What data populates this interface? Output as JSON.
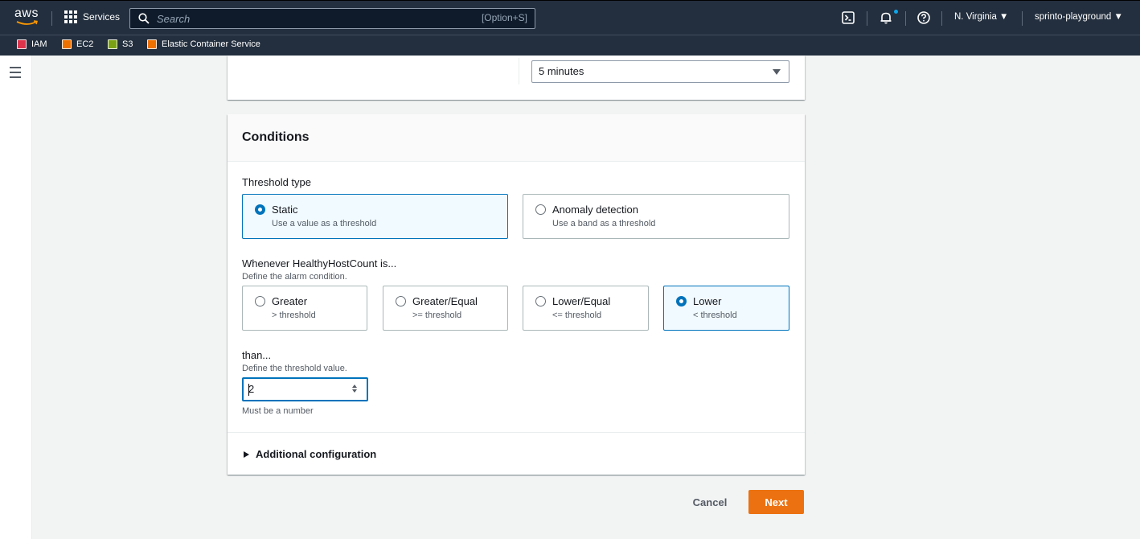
{
  "topnav": {
    "logo_text": "aws",
    "services_label": "Services",
    "search_placeholder": "Search",
    "search_shortcut": "[Option+S]",
    "region": "N. Virginia ▼",
    "account": "sprinto-playground ▼"
  },
  "favorites": [
    {
      "label": "IAM",
      "color": "#dd344c"
    },
    {
      "label": "EC2",
      "color": "#ed7100"
    },
    {
      "label": "S3",
      "color": "#7aa116"
    },
    {
      "label": "Elastic Container Service",
      "color": "#ed7100"
    }
  ],
  "period_select": {
    "value": "5 minutes"
  },
  "conditions": {
    "title": "Conditions",
    "threshold_type_label": "Threshold type",
    "threshold_types": [
      {
        "title": "Static",
        "sub": "Use a value as a threshold",
        "selected": true
      },
      {
        "title": "Anomaly detection",
        "sub": "Use a band as a threshold",
        "selected": false
      }
    ],
    "whenever_label": "Whenever HealthyHostCount is...",
    "whenever_desc": "Define the alarm condition.",
    "operators": [
      {
        "title": "Greater",
        "sub": "> threshold",
        "selected": false
      },
      {
        "title": "Greater/Equal",
        "sub": ">= threshold",
        "selected": false
      },
      {
        "title": "Lower/Equal",
        "sub": "<= threshold",
        "selected": false
      },
      {
        "title": "Lower",
        "sub": "< threshold",
        "selected": true
      }
    ],
    "than_label": "than...",
    "than_desc": "Define the threshold value.",
    "threshold_value": "2",
    "constraint": "Must be a number",
    "additional_config": "Additional configuration"
  },
  "actions": {
    "cancel": "Cancel",
    "next": "Next"
  },
  "colors": {
    "accent": "#0073bb",
    "primary_button": "#ec7211",
    "nav_bg": "#232f3e"
  }
}
